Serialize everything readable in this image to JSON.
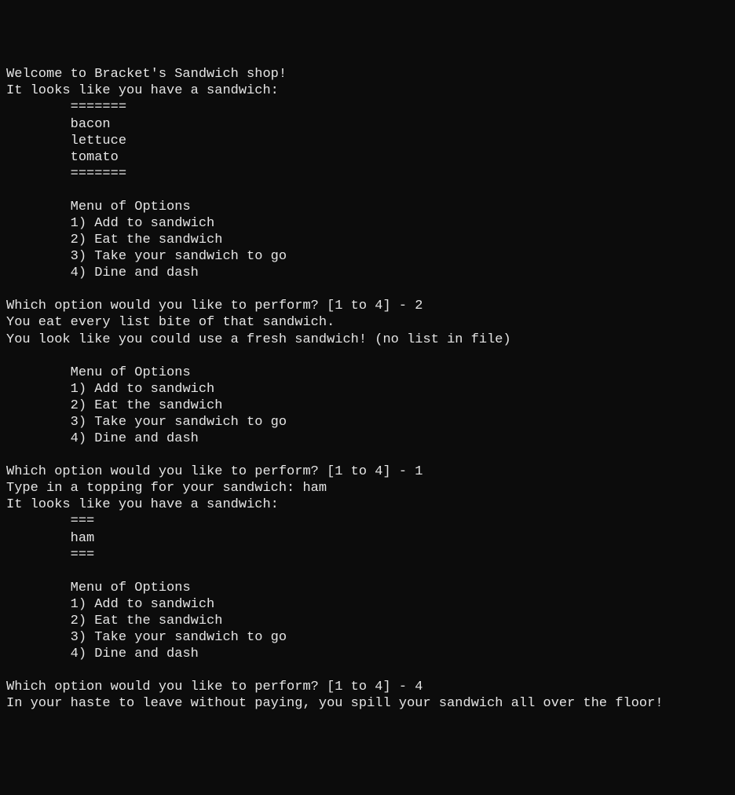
{
  "terminal": {
    "welcome": "Welcome to Bracket's Sandwich shop!",
    "have_sandwich": "It looks like you have a sandwich:",
    "sandwich1": {
      "border": "=======",
      "topping1": "bacon",
      "topping2": "lettuce",
      "topping3": "tomato"
    },
    "menu_header": "Menu of Options",
    "menu_1": "1) Add to sandwich",
    "menu_2": "2) Eat the sandwich",
    "menu_3": "3) Take your sandwich to go",
    "menu_4": "4) Dine and dash",
    "prompt": "Which option would you like to perform? [1 to 4] - ",
    "input1": "2",
    "eat_msg": "You eat every list bite of that sandwich.",
    "fresh_msg": "You look like you could use a fresh sandwich! (no list in file)",
    "input2": "1",
    "topping_prompt": "Type in a topping for your sandwich: ",
    "topping_input": "ham",
    "sandwich2": {
      "border": "===",
      "topping1": "ham"
    },
    "input3": "4",
    "dash_msg": "In your haste to leave without paying, you spill your sandwich all over the floor!",
    "indent": "        "
  }
}
